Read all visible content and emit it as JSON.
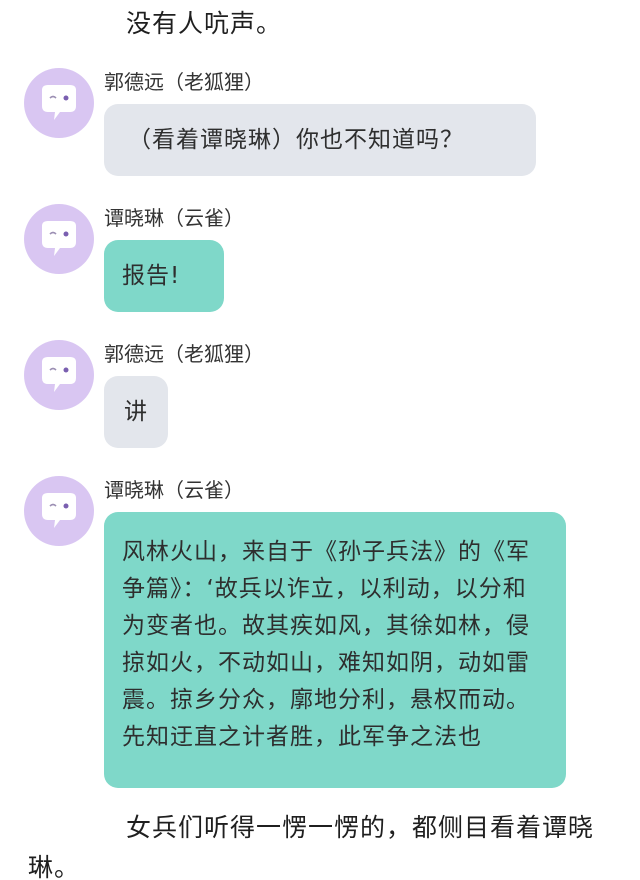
{
  "narration": {
    "top": "没有人吭声。",
    "bottom": "女兵们听得一愣一愣的，都侧目看着谭晓琳。"
  },
  "messages": [
    {
      "sender": "郭德远（老狐狸）",
      "text": "（看着谭晓琳）你也不知道吗？",
      "bubble_color": "#e3e6ec"
    },
    {
      "sender": "谭晓琳（云雀）",
      "text": "报告!",
      "bubble_color": "#7fd8c9"
    },
    {
      "sender": "郭德远（老狐狸）",
      "text": "讲",
      "bubble_color": "#e3e6ec"
    },
    {
      "sender": "谭晓琳（云雀）",
      "text": "风林火山，来自于《孙子兵法》的《军争篇》：‘故兵以诈立，以利动，以分和为变者也。故其疾如风，其徐如林，侵掠如火，不动如山，难知如阴，动如雷震。掠乡分众，廓地分利，悬权而动。先知迂直之计者胜，此军争之法也",
      "bubble_color": "#7fd8c9"
    }
  ],
  "avatar_icon": "speech-bubble-face-icon",
  "colors": {
    "avatar_bg": "#d9c6f2",
    "gray_bubble": "#e3e6ec",
    "teal_bubble": "#7fd8c9"
  }
}
